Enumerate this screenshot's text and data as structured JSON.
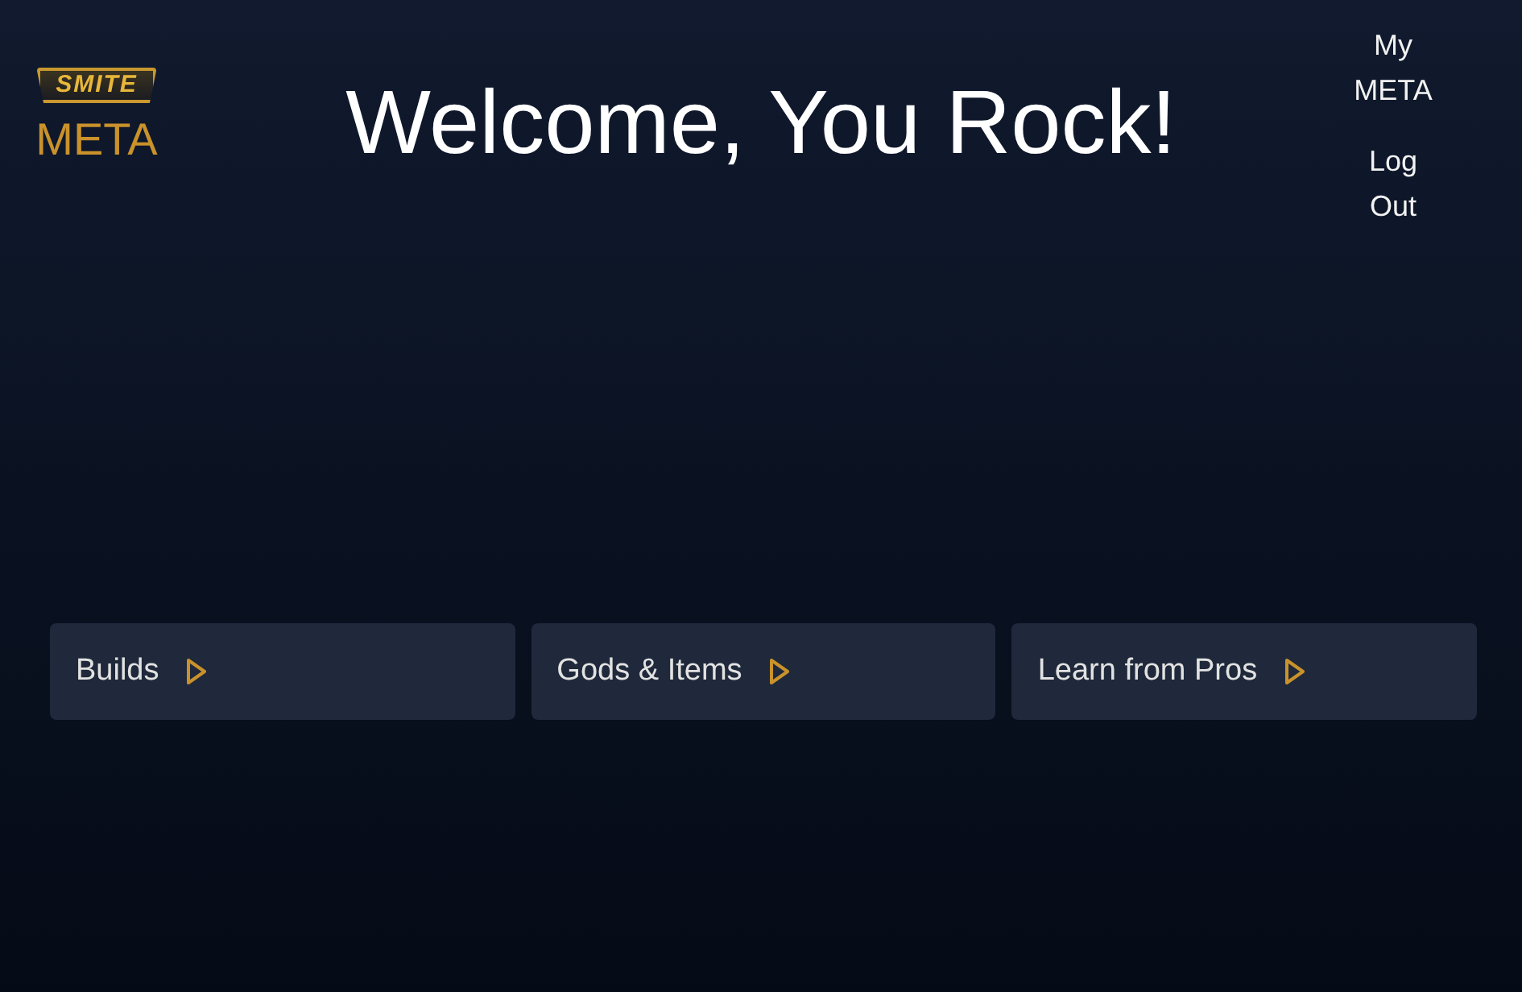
{
  "logo": {
    "badge": "SMITE",
    "subtitle": "META"
  },
  "title": "Welcome, You Rock!",
  "nav": [
    {
      "label": "My META"
    },
    {
      "label": "Log Out"
    }
  ],
  "cards": [
    {
      "label": "Builds"
    },
    {
      "label": "Gods & Items"
    },
    {
      "label": "Learn from Pros"
    }
  ]
}
